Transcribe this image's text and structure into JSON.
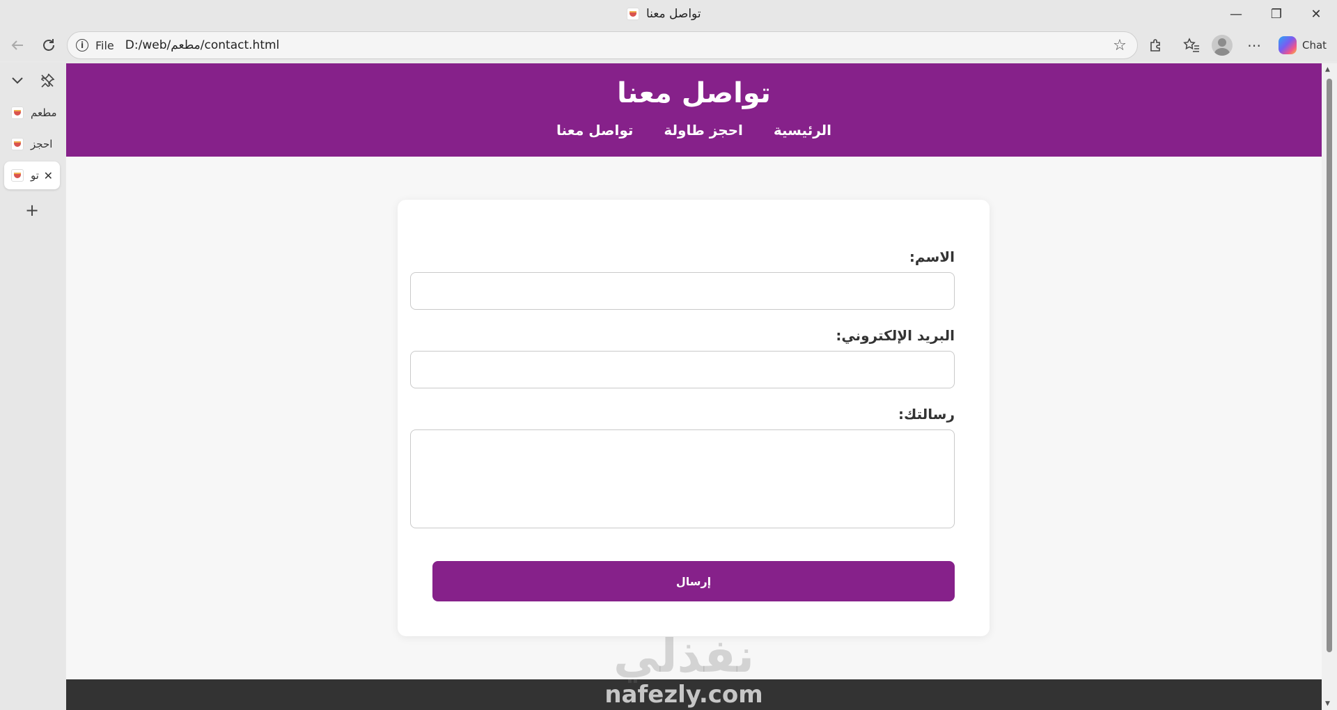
{
  "window": {
    "title": "تواصل معنا",
    "minimize_glyph": "—",
    "restore_glyph": "❐",
    "close_glyph": "✕"
  },
  "toolbar": {
    "scheme_label": "File",
    "url": "D:/web/مطعم/contact.html",
    "chat_label": "Chat"
  },
  "tabs": [
    {
      "label": "مطعم",
      "active": false
    },
    {
      "label": "احجز",
      "active": false
    },
    {
      "label": "تو",
      "active": true
    }
  ],
  "site": {
    "title": "تواصل معنا",
    "nav": [
      {
        "label": "الرئيسية"
      },
      {
        "label": "احجز طاولة"
      },
      {
        "label": "تواصل معنا"
      }
    ]
  },
  "form": {
    "name_label": "الاسم:",
    "name_value": "",
    "email_label": "البريد الإلكتروني:",
    "email_value": "",
    "message_label": "رسالتك:",
    "message_value": "",
    "submit_label": "إرسال"
  },
  "watermark": {
    "arabic": "نفذلي",
    "latin": "nafezly.com"
  },
  "colors": {
    "brand": "#86218a",
    "footer": "#333333",
    "page_bg": "#f7f7f7"
  }
}
